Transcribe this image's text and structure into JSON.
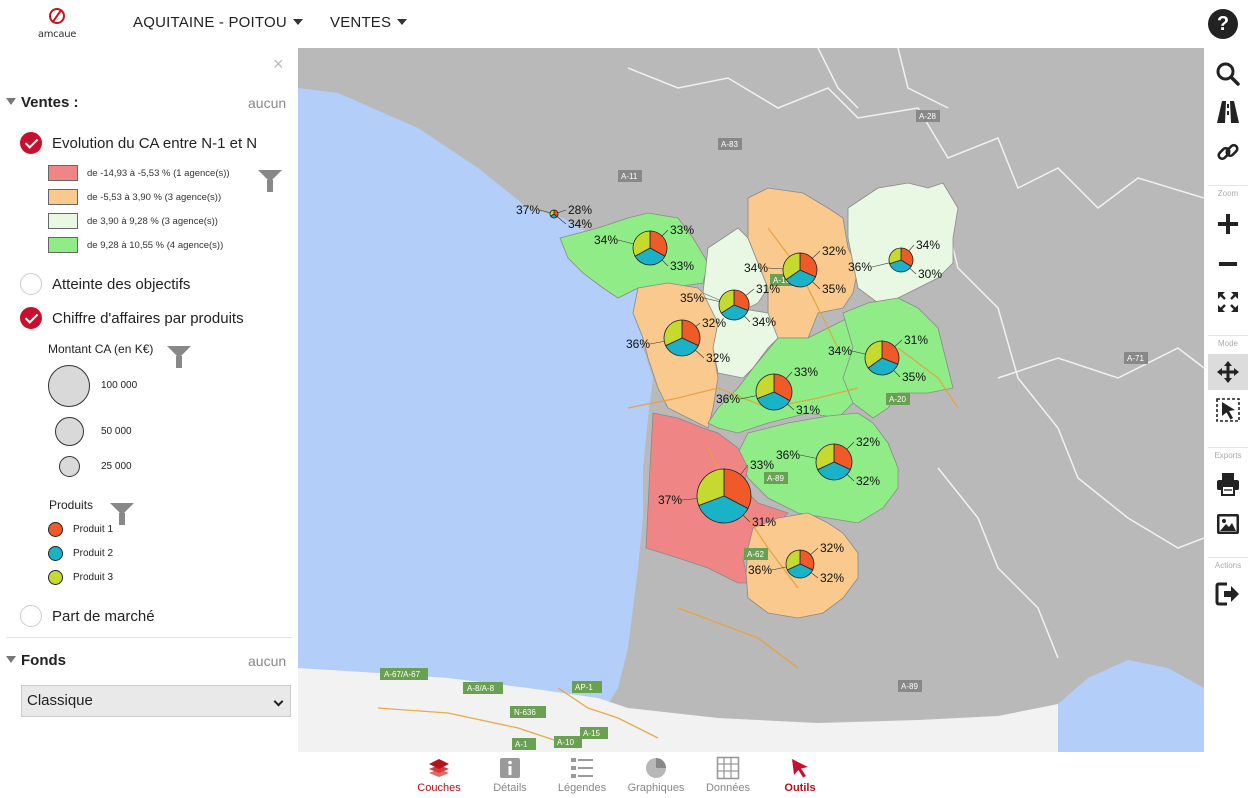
{
  "header": {
    "logo_text": "amcaue",
    "menu": [
      {
        "label": "AQUITAINE - POITOU"
      },
      {
        "label": "VENTES"
      }
    ],
    "help_label": "?"
  },
  "panel": {
    "close_label": "×",
    "ventes": {
      "title": "Ventes :",
      "action": "aucun",
      "layers": [
        {
          "label": "Evolution du CA entre N-1 et N",
          "checked": true
        },
        {
          "label": "Atteinte des objectifs",
          "checked": false
        },
        {
          "label": "Chiffre d'affaires par produits",
          "checked": true
        },
        {
          "label": "Part de marché",
          "checked": false
        }
      ],
      "evolution_legend": [
        {
          "label": "de -14,93 à -5,53 % (1 agence(s))",
          "color": "#ef8585"
        },
        {
          "label": "de -5,53 à 3,90 % (3 agence(s))",
          "color": "#f9c98e"
        },
        {
          "label": "de 3,90 à 9,28 % (3 agence(s))",
          "color": "#e8f8e3"
        },
        {
          "label": "de 9,28 à 10,55 % (4 agence(s))",
          "color": "#8fec87"
        }
      ],
      "montant_title": "Montant CA (en K€)",
      "montant_legend": [
        {
          "label": "100 000"
        },
        {
          "label": "50 000"
        },
        {
          "label": "25 000"
        }
      ],
      "produits_title": "Produits",
      "produits": [
        {
          "label": "Produit 1",
          "color": "#f05a28"
        },
        {
          "label": "Produit 2",
          "color": "#1ab2c7"
        },
        {
          "label": "Produit 3",
          "color": "#c5d92e"
        }
      ]
    },
    "fonds": {
      "title": "Fonds",
      "action": "aucun",
      "selected": "Classique"
    }
  },
  "map": {
    "regions": [
      {
        "name": "vendee",
        "color": "#8fec87"
      },
      {
        "name": "deux-sevres",
        "color": "#e8f8e3"
      },
      {
        "name": "vienne",
        "color": "#f9c98e"
      },
      {
        "name": "indre",
        "color": "#e8f8e3"
      },
      {
        "name": "charente-maritime",
        "color": "#f9c98e"
      },
      {
        "name": "charente-maritime-nord",
        "color": "#e8f8e3"
      },
      {
        "name": "charente",
        "color": "#8fec87"
      },
      {
        "name": "haute-vienne",
        "color": "#8fec87"
      },
      {
        "name": "dordogne",
        "color": "#8fec87"
      },
      {
        "name": "gironde",
        "color": "#ef8585"
      },
      {
        "name": "lot-et-garonne",
        "color": "#f9c98e"
      }
    ],
    "pies": [
      {
        "labels": [
          "33%",
          "34%",
          "33%"
        ]
      },
      {
        "labels": [
          "37%",
          "28%",
          "34%"
        ]
      },
      {
        "labels": [
          "32%",
          "34%",
          "35%"
        ]
      },
      {
        "labels": [
          "34%",
          "36%",
          "30%"
        ]
      },
      {
        "labels": [
          "31%",
          "35%",
          "34%"
        ]
      },
      {
        "labels": [
          "32%",
          "36%",
          "32%"
        ]
      },
      {
        "labels": [
          "31%",
          "34%",
          "35%"
        ]
      },
      {
        "labels": [
          "33%",
          "36%",
          "31%"
        ]
      },
      {
        "labels": [
          "32%",
          "36%",
          "32%"
        ]
      },
      {
        "labels": [
          "33%",
          "37%",
          "31%"
        ]
      },
      {
        "labels": [
          "32%",
          "36%",
          "32%"
        ]
      }
    ],
    "road_labels": [
      "A-67/A-67",
      "A-8/A-8",
      "AP-1",
      "N-636",
      "A-15",
      "A-1",
      "A-10",
      "A-20",
      "A-89",
      "A-62",
      "A-10",
      "A-83",
      "A-11",
      "A-28",
      "A-71",
      "A-89"
    ]
  },
  "toolbar": {
    "groups": [
      "Zoom",
      "Mode",
      "Exports",
      "Actions"
    ]
  },
  "bottom_tabs": [
    {
      "label": "Couches",
      "active": true
    },
    {
      "label": "Détails",
      "active": false
    },
    {
      "label": "Légendes",
      "active": false
    },
    {
      "label": "Graphiques",
      "active": false
    },
    {
      "label": "Données",
      "active": false
    },
    {
      "label": "Outils",
      "active": true
    }
  ]
}
